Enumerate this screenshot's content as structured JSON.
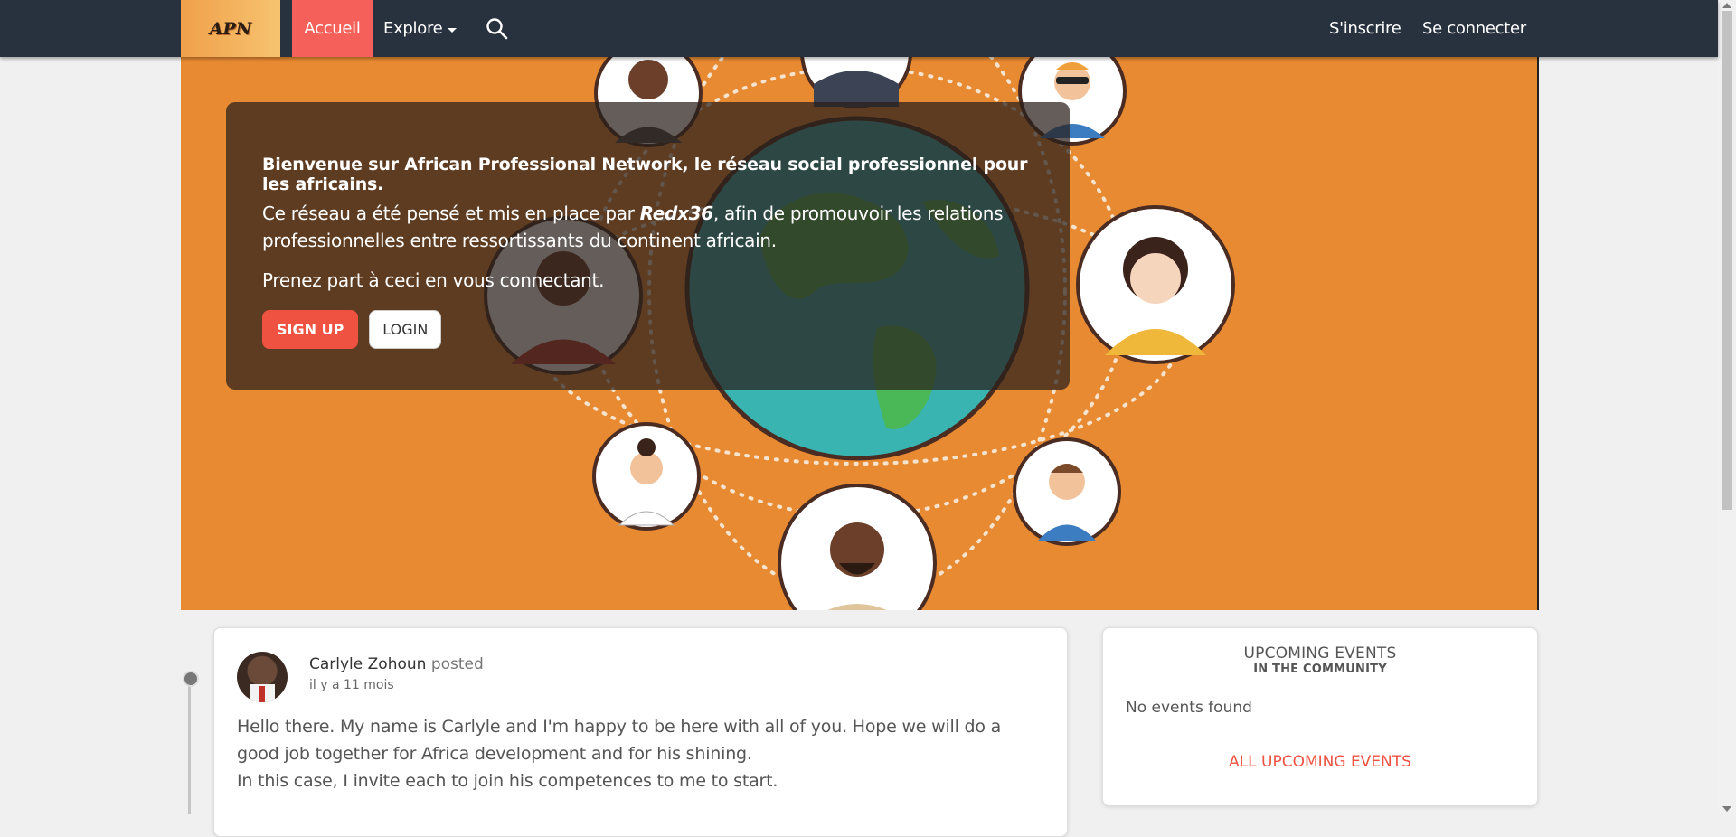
{
  "nav": {
    "logo_text": "APN",
    "home": "Accueil",
    "explore": "Explore",
    "signup": "S'inscrire",
    "login": "Se connecter"
  },
  "hero": {
    "headline": "Bienvenue sur African Professional Network, le réseau social professionnel pour les africains.",
    "intro_before": "Ce réseau a été pensé et mis en place par ",
    "author": "Redx36",
    "intro_after": ", afin de promouvoir les relations professionnelles entre ressortissants du continent africain.",
    "cta_text": "Prenez part à ceci en vous connectant.",
    "signup_button": "SIGN UP",
    "login_button": "LOGIN"
  },
  "post": {
    "author": "Carlyle Zohoun",
    "action": "posted",
    "time": "il y a 11 mois",
    "line1": "Hello there. My name is Carlyle and I'm happy to be here with all of you. Hope we will do a good job together for Africa development and for his shining.",
    "line2": "In this case, I invite each to join his competences to me to start."
  },
  "events": {
    "title": "UPCOMING EVENTS",
    "subtitle": "IN THE COMMUNITY",
    "empty": "No events found",
    "link": "ALL UPCOMING EVENTS"
  },
  "colors": {
    "topbar": "#28323f",
    "accent": "#f5615a",
    "hero_bg": "#e88a32",
    "button_red": "#f05242"
  },
  "icons": [
    "search-icon",
    "chevron-down-icon"
  ]
}
